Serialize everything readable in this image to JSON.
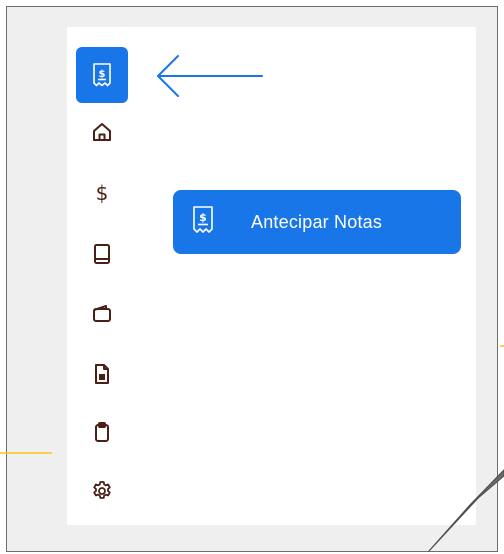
{
  "sidebar": {
    "items": [
      {
        "icon": "receipt-dollar-icon",
        "active": true
      },
      {
        "icon": "home-icon"
      },
      {
        "icon": "dollar-icon",
        "glyph": "$"
      },
      {
        "icon": "book-icon"
      },
      {
        "icon": "wallet-icon"
      },
      {
        "icon": "document-icon"
      },
      {
        "icon": "clipboard-icon"
      },
      {
        "icon": "gear-icon"
      }
    ]
  },
  "action_button": {
    "icon": "receipt-dollar-icon",
    "label": "Antecipar Notas"
  },
  "colors": {
    "accent": "#1976e8",
    "icon": "#4a1f15",
    "annotation_yellow": "#f5c518",
    "frame_background": "#efefef"
  }
}
